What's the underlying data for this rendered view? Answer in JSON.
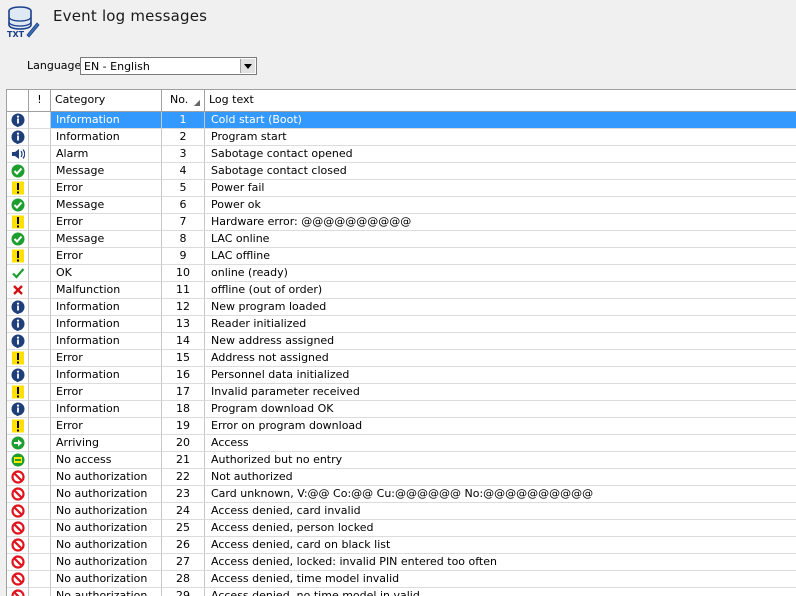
{
  "header": {
    "title": "Event log messages",
    "app_icon": "txt-database-icon",
    "app_icon_label": "TXT"
  },
  "language": {
    "label": "Language",
    "value": "EN - English"
  },
  "table": {
    "columns": {
      "icon": "",
      "flag": "!",
      "category": "Category",
      "no": "No.",
      "text": "Log text"
    },
    "rows": [
      {
        "icon": "info",
        "category": "Information",
        "no": "1",
        "text": "Cold start (Boot)",
        "selected": true
      },
      {
        "icon": "info",
        "category": "Information",
        "no": "2",
        "text": "Program start"
      },
      {
        "icon": "speaker",
        "category": "Alarm",
        "no": "3",
        "text": "Sabotage contact opened"
      },
      {
        "icon": "check-circle",
        "category": "Message",
        "no": "4",
        "text": "Sabotage contact closed"
      },
      {
        "icon": "warning",
        "category": "Error",
        "no": "5",
        "text": "Power fail"
      },
      {
        "icon": "check-circle",
        "category": "Message",
        "no": "6",
        "text": "Power ok"
      },
      {
        "icon": "warning",
        "category": "Error",
        "no": "7",
        "text": "Hardware error: @@@@@@@@@@"
      },
      {
        "icon": "check-circle",
        "category": "Message",
        "no": "8",
        "text": "LAC online"
      },
      {
        "icon": "warning",
        "category": "Error",
        "no": "9",
        "text": "LAC offline"
      },
      {
        "icon": "check",
        "category": "OK",
        "no": "10",
        "text": "online (ready)"
      },
      {
        "icon": "cross",
        "category": "Malfunction",
        "no": "11",
        "text": "offline (out of order)"
      },
      {
        "icon": "info",
        "category": "Information",
        "no": "12",
        "text": "New program loaded"
      },
      {
        "icon": "info",
        "category": "Information",
        "no": "13",
        "text": "Reader initialized"
      },
      {
        "icon": "info",
        "category": "Information",
        "no": "14",
        "text": "New address assigned"
      },
      {
        "icon": "warning",
        "category": "Error",
        "no": "15",
        "text": "Address not assigned"
      },
      {
        "icon": "info",
        "category": "Information",
        "no": "16",
        "text": "Personnel data initialized"
      },
      {
        "icon": "warning",
        "category": "Error",
        "no": "17",
        "text": "Invalid parameter received"
      },
      {
        "icon": "info",
        "category": "Information",
        "no": "18",
        "text": "Program download OK"
      },
      {
        "icon": "warning",
        "category": "Error",
        "no": "19",
        "text": "Error on program download"
      },
      {
        "icon": "arrow-right",
        "category": "Arriving",
        "no": "20",
        "text": "Access"
      },
      {
        "icon": "arrow-left",
        "category": "No access",
        "no": "21",
        "text": "Authorized but no entry"
      },
      {
        "icon": "prohibited",
        "category": "No authorization",
        "no": "22",
        "text": "Not authorized"
      },
      {
        "icon": "prohibited",
        "category": "No authorization",
        "no": "23",
        "text": "Card unknown, V:@@ Co:@@ Cu:@@@@@@ No:@@@@@@@@@@"
      },
      {
        "icon": "prohibited",
        "category": "No authorization",
        "no": "24",
        "text": "Access denied, card invalid"
      },
      {
        "icon": "prohibited",
        "category": "No authorization",
        "no": "25",
        "text": "Access denied, person locked"
      },
      {
        "icon": "prohibited",
        "category": "No authorization",
        "no": "26",
        "text": "Access denied, card on black list"
      },
      {
        "icon": "prohibited",
        "category": "No authorization",
        "no": "27",
        "text": "Access denied, locked: invalid PIN entered too often"
      },
      {
        "icon": "prohibited",
        "category": "No authorization",
        "no": "28",
        "text": "Access denied, time model invalid"
      },
      {
        "icon": "prohibited",
        "category": "No authorization",
        "no": "29",
        "text": "Access denied, no time model in valid"
      }
    ]
  },
  "colors": {
    "selection": "#3399ff",
    "info": "#1f3f7a",
    "check": "#1e9e2e",
    "warning": "#ffe000",
    "prohibited": "#e0141e",
    "cross": "#d01010"
  }
}
